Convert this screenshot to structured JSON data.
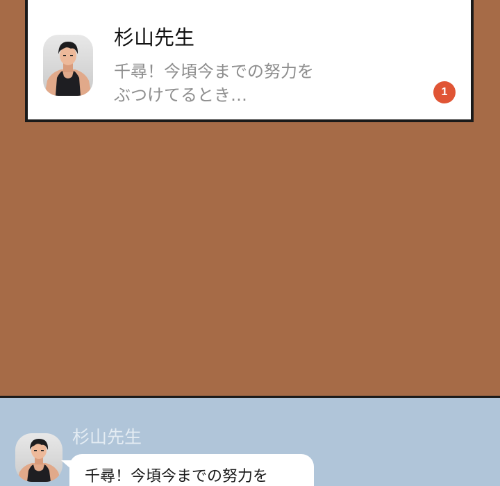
{
  "notification": {
    "sender": "杉山先生",
    "preview_line1": "千尋！今頃今までの努力を",
    "preview_line2": "ぶつけてるとき…",
    "unread_count": "1",
    "avatar": "avatar-man-tank-top"
  },
  "chat": {
    "sender": "杉山先生",
    "message_line1": "千尋！今頃今までの努力を",
    "avatar": "avatar-man-tank-top"
  },
  "colors": {
    "background": "#A66B47",
    "card": "#FFFFFF",
    "card_border": "#1A1A1A",
    "badge": "#E05535",
    "chat_panel": "#B0C5D9",
    "preview_text": "#8E8E8E"
  }
}
